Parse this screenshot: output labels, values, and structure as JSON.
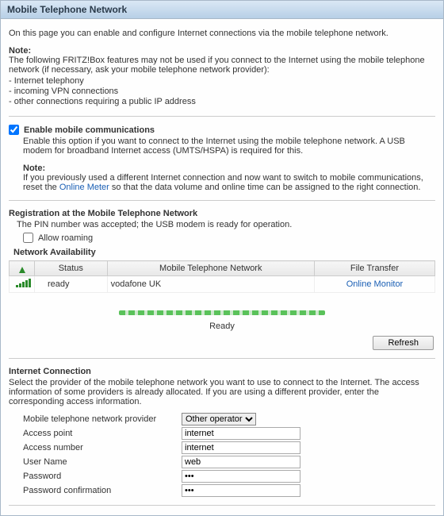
{
  "title": "Mobile Telephone Network",
  "intro": "On this page you can enable and configure Internet connections via the mobile telephone network.",
  "note1": {
    "heading": "Note:",
    "text": "The following FRITZ!Box features may not be used if you connect to the Internet using the mobile telephone network (if necessary, ask your mobile telephone network provider):",
    "items": [
      "- Internet telephony",
      "- incoming VPN connections",
      "- other connections requiring a public IP address"
    ]
  },
  "enable": {
    "label": "Enable mobile communications",
    "desc": "Enable this option if you want to connect to the Internet using the mobile telephone network. A USB modem for broadband Internet access (UMTS/HSPA) is required for this.",
    "note_heading": "Note:",
    "note_text_pre": "If you previously used a different Internet connection and now want to switch to mobile communications, reset the ",
    "note_link": "Online Meter",
    "note_text_post": " so that the data volume and online time can be assigned to the right connection."
  },
  "registration": {
    "heading": "Registration at the Mobile Telephone Network",
    "status": "The PIN number was accepted; the USB modem is ready for operation.",
    "roaming_label": "Allow roaming"
  },
  "availability": {
    "heading": "Network Availability",
    "cols": [
      "",
      "Status",
      "Mobile Telephone Network",
      "File Transfer"
    ],
    "row": {
      "status": "ready",
      "network": "vodafone UK",
      "transfer": "Online Monitor"
    },
    "ready_label": "Ready",
    "refresh": "Refresh"
  },
  "internet": {
    "heading": "Internet Connection",
    "desc": "Select the provider of the mobile telephone network you want to use to connect to the Internet. The access information of some providers is already allocated. If you are using a different provider, enter the corresponding access information.",
    "provider_label": "Mobile telephone network provider",
    "provider_value": "Other operator",
    "ap_label": "Access point",
    "ap_value": "internet",
    "an_label": "Access number",
    "an_value": "internet",
    "user_label": "User Name",
    "user_value": "web",
    "pw_label": "Password",
    "pw_value": "•••",
    "pwc_label": "Password confirmation",
    "pwc_value": "•••"
  }
}
